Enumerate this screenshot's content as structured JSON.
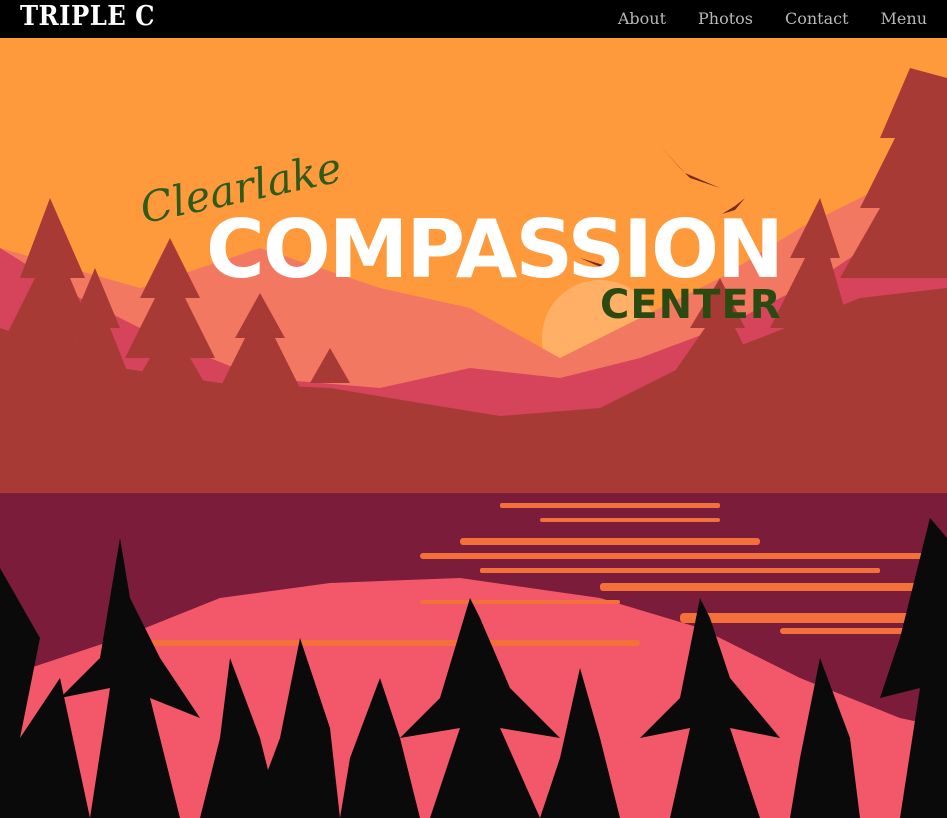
{
  "nav": {
    "brand": "TRIPLE C",
    "links": [
      "About",
      "Photos",
      "Contact",
      "Menu"
    ]
  },
  "hero": {
    "logo_script": "Clearlake",
    "logo_main": "COMPASSION",
    "logo_sub": "CENTER"
  },
  "colors": {
    "sky": "#ff9a3c",
    "mountain_far": "#f37862",
    "mountain_mid": "#d5445a",
    "hills": "#a83a36",
    "lake": "#7b1c3a",
    "reflection": "#f3576a",
    "leaves": "#0a0a0a",
    "logo_green": "#2b4a12"
  }
}
